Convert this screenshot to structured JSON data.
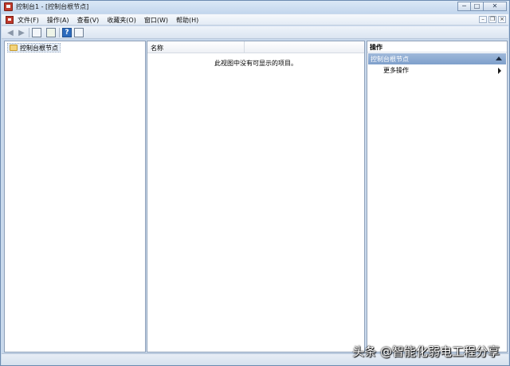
{
  "window": {
    "title": "控制台1 - [控制台根节点]",
    "caption": {
      "minimize": "─",
      "maximize": "□",
      "close": "✕"
    }
  },
  "menubar": {
    "items": [
      "文件(F)",
      "操作(A)",
      "查看(V)",
      "收藏夹(O)",
      "窗口(W)",
      "帮助(H)"
    ],
    "mdi": {
      "minimize": "–",
      "restore": "❐",
      "close": "×"
    }
  },
  "toolbar": {
    "back": "◀",
    "forward": "▶",
    "help": "?"
  },
  "tree": {
    "root_label": "控制台根节点"
  },
  "list": {
    "column_name": "名称",
    "empty_message": "此视图中没有可显示的项目。"
  },
  "actions": {
    "title": "操作",
    "group_label": "控制台根节点",
    "more_actions": "更多操作"
  },
  "watermark": "头条 @智能化弱电工程分享"
}
